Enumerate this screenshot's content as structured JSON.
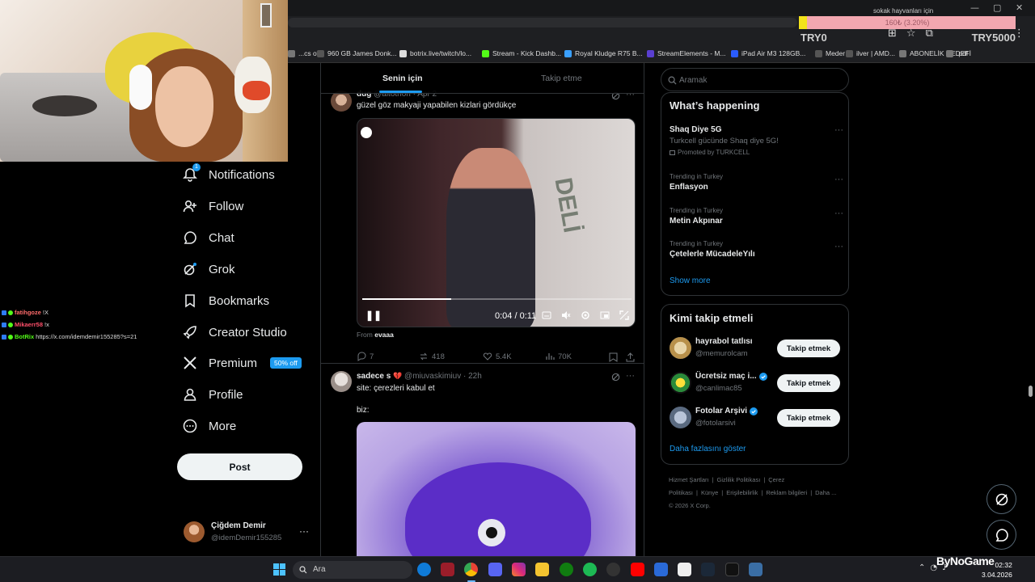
{
  "browser": {
    "bookmarks": [
      {
        "label": "...cs of...",
        "icon": "page-icon",
        "color": "#777777"
      },
      {
        "label": "960 GB James Donk...",
        "icon": "bookmark-icon",
        "color": "#555555"
      },
      {
        "label": "botrix.live/twitch/lo...",
        "icon": "botrix-icon",
        "color": "#dddddd"
      },
      {
        "label": "Stream - Kick Dashb...",
        "icon": "kick-icon",
        "color": "#53fc18"
      },
      {
        "label": "Royal Kludge R75 B...",
        "icon": "diamond-icon",
        "color": "#3aa0ff"
      },
      {
        "label": "StreamElements - M...",
        "icon": "streamelements-icon",
        "color": "#5a3fd0"
      },
      {
        "label": "iPad Air M3 128GB...",
        "icon": "v-icon",
        "color": "#2a5cff"
      },
      {
        "label": "Meder",
        "icon": "bookmark-icon",
        "color": "#555555"
      },
      {
        "label": "ilver | AMD...",
        "icon": "page-icon",
        "color": "#555555"
      },
      {
        "label": "ABONELİK HEDEFİ",
        "icon": "page-icon",
        "color": "#777777"
      },
      {
        "label": ".pdf",
        "icon": "pdf-icon",
        "color": "#777777"
      }
    ]
  },
  "stream": {
    "donation_label": "sokak hayvanları için",
    "donation_progress_text": "160₺ (3.20%)",
    "donation_progress_fraction": 0.032,
    "donation_min": "TRY0",
    "donation_max": "TRY5000",
    "chat": [
      {
        "user": "fatihgoze",
        "message": "!X",
        "color": "#ff6b6b"
      },
      {
        "user": "Mikaerr58",
        "message": "!x",
        "color": "#ff4f6a"
      },
      {
        "user": "BotRix",
        "message": "https://x.com/idemdemir155285?s=21",
        "color": "#53fc18"
      }
    ],
    "brand": "ByNoGame"
  },
  "nav": {
    "items": [
      {
        "label": "Notifications",
        "icon": "bell-icon",
        "badge": "1"
      },
      {
        "label": "Follow",
        "icon": "follow-icon"
      },
      {
        "label": "Chat",
        "icon": "chat-icon"
      },
      {
        "label": "Grok",
        "icon": "grok-icon"
      },
      {
        "label": "Bookmarks",
        "icon": "bookmark-icon"
      },
      {
        "label": "Creator Studio",
        "icon": "rocket-icon"
      },
      {
        "label": "Premium",
        "icon": "x-logo-icon",
        "pill": "50% off"
      },
      {
        "label": "Profile",
        "icon": "person-icon"
      },
      {
        "label": "More",
        "icon": "more-circle-icon"
      }
    ],
    "post_button": "Post",
    "account": {
      "name": "Çiğdem Demir",
      "handle": "@idemDemir155285",
      "more": "···"
    }
  },
  "timeline": {
    "tabs": [
      {
        "label": "Senin için",
        "active": true
      },
      {
        "label": "Takip etme",
        "active": false
      }
    ],
    "tweets": [
      {
        "name": "dug",
        "handle": "@aitothon",
        "time": "· Apr 2",
        "text": "güzel göz makyaji yapabilen kizlari gördükçe",
        "video_time": "0:04 / 0:11",
        "video_progress_fraction": 0.33,
        "from_label": "From",
        "from_user": "evaaa",
        "replies": "7",
        "reposts": "418",
        "likes": "5.4K",
        "views": "70K",
        "more": "···"
      },
      {
        "name": "sadece s",
        "handle": "@miuvaskimiuv",
        "time": "· 22h",
        "text": "site: çerezleri kabul et",
        "text2": "biz:",
        "more": "···"
      }
    ]
  },
  "right": {
    "search_placeholder": "Aramak",
    "happening": {
      "title": "What’s happening",
      "trends": [
        {
          "context": "",
          "name": "Shaq Diye 5G",
          "desc": "Turkcell gücünde Shaq diye 5G!",
          "promo": "Promoted by TURKCELL"
        },
        {
          "context": "Trending in Turkey",
          "name": "Enflasyon"
        },
        {
          "context": "Trending in Turkey",
          "name": "Metin Akpınar"
        },
        {
          "context": "Trending in Turkey",
          "name": "Çetelerle MücadeleYılı"
        }
      ],
      "show_more": "Show more"
    },
    "who_to_follow": {
      "title": "Kimi takip etmeli",
      "accounts": [
        {
          "name": "hayrabol tatlısı",
          "handle": "@memurolcam",
          "verified": false,
          "button": "Takip etmek"
        },
        {
          "name": "Ücretsiz maç i...",
          "handle": "@canlimac85",
          "verified": true,
          "button": "Takip etmek"
        },
        {
          "name": "Fotolar Arşivi",
          "handle": "@fotolarsivi",
          "verified": true,
          "button": "Takip etmek"
        }
      ],
      "show_more": "Daha fazlasını göster"
    },
    "footer": {
      "links": [
        "Hizmet Şartları",
        "|",
        "Gizlilik Politikası",
        "|",
        "Çerez Politikası",
        "|",
        "Künye",
        "|",
        "Erişilebilirlik",
        "|",
        "Reklam bilgileri",
        "|",
        "Daha ..."
      ],
      "copyright": "© 2026 X Corp."
    }
  },
  "taskbar": {
    "search_label": "Ara",
    "time": "02:32",
    "date": "3.04.2026"
  },
  "colors": {
    "accent": "#1d9bf0",
    "background": "#000000",
    "border": "#2f3336",
    "muted_text": "#71767b"
  }
}
